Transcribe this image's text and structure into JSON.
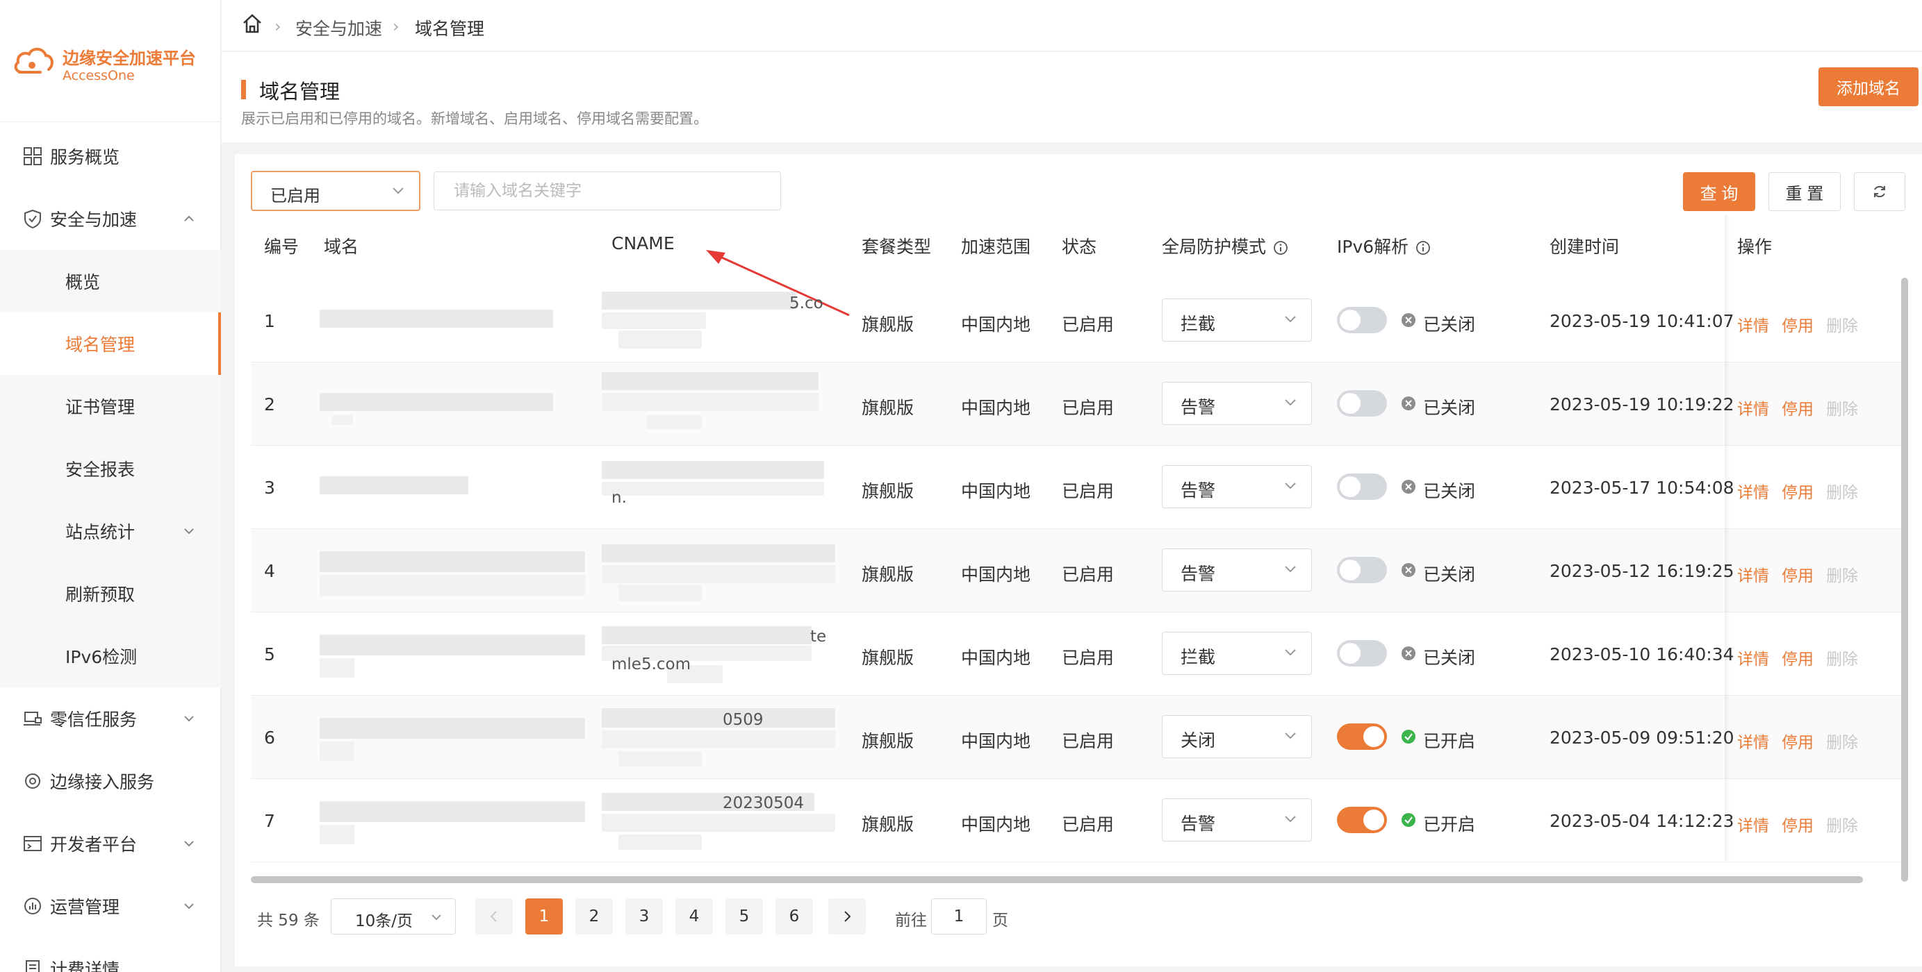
{
  "brand": {
    "name_cn": "边缘安全加速平台",
    "name_en": "AccessOne",
    "color": "#ec7b37"
  },
  "breadcrumb": [
    "安全与加速",
    "域名管理"
  ],
  "sidebar": {
    "items": [
      {
        "label": "服务概览",
        "icon": "grid-icon"
      },
      {
        "label": "安全与加速",
        "icon": "shield-icon",
        "expanded": true
      },
      {
        "label": "零信任服务",
        "icon": "laptop-lock-icon"
      },
      {
        "label": "边缘接入服务",
        "icon": "edge-icon"
      },
      {
        "label": "开发者平台",
        "icon": "console-icon"
      },
      {
        "label": "运营管理",
        "icon": "chart-icon"
      },
      {
        "label": "计费详情",
        "icon": "bill-icon"
      }
    ],
    "sub_items": [
      {
        "label": "概览"
      },
      {
        "label": "域名管理",
        "active": true
      },
      {
        "label": "证书管理"
      },
      {
        "label": "安全报表"
      },
      {
        "label": "站点统计"
      },
      {
        "label": "刷新预取"
      },
      {
        "label": "IPv6检测"
      }
    ]
  },
  "page": {
    "title": "域名管理",
    "description": "展示已启用和已停用的域名。新增域名、启用域名、停用域名需要配置。",
    "add_button": "添加域名"
  },
  "filters": {
    "status_value": "已启用",
    "search_placeholder": "请输入域名关键字",
    "query_button": "查 询",
    "reset_button": "重 置"
  },
  "table": {
    "headers": [
      "编号",
      "域名",
      "CNAME",
      "套餐类型",
      "加速范围",
      "状态",
      "全局防护模式",
      "IPv6解析",
      "创建时间",
      "操作"
    ],
    "rows": [
      {
        "id": "1",
        "cname_frag": "5.co",
        "cname_frag2": "",
        "plan": "旗舰版",
        "scope": "中国内地",
        "status": "已启用",
        "mode": "拦截",
        "ipv6_on": false,
        "ipv6_text": "已关闭",
        "created": "2023-05-19 10:41:07"
      },
      {
        "id": "2",
        "cname_frag": "",
        "cname_frag2": "",
        "plan": "旗舰版",
        "scope": "中国内地",
        "status": "已启用",
        "mode": "告警",
        "ipv6_on": false,
        "ipv6_text": "已关闭",
        "created": "2023-05-19 10:19:22"
      },
      {
        "id": "3",
        "cname_frag": "",
        "cname_frag2": "n.",
        "plan": "旗舰版",
        "scope": "中国内地",
        "status": "已启用",
        "mode": "告警",
        "ipv6_on": false,
        "ipv6_text": "已关闭",
        "created": "2023-05-17 10:54:08"
      },
      {
        "id": "4",
        "cname_frag": "",
        "cname_frag2": "",
        "plan": "旗舰版",
        "scope": "中国内地",
        "status": "已启用",
        "mode": "告警",
        "ipv6_on": false,
        "ipv6_text": "已关闭",
        "created": "2023-05-12 16:19:25"
      },
      {
        "id": "5",
        "cname_frag": "te",
        "cname_frag2": "mle5.com",
        "plan": "旗舰版",
        "scope": "中国内地",
        "status": "已启用",
        "mode": "拦截",
        "ipv6_on": false,
        "ipv6_text": "已关闭",
        "created": "2023-05-10 16:40:34"
      },
      {
        "id": "6",
        "cname_frag": "0509",
        "cname_frag2": "",
        "plan": "旗舰版",
        "scope": "中国内地",
        "status": "已启用",
        "mode": "关闭",
        "ipv6_on": true,
        "ipv6_text": "已开启",
        "created": "2023-05-09 09:51:20"
      },
      {
        "id": "7",
        "cname_frag": "20230504",
        "cname_frag2": "",
        "plan": "旗舰版",
        "scope": "中国内地",
        "status": "已启用",
        "mode": "告警",
        "ipv6_on": true,
        "ipv6_text": "已开启",
        "created": "2023-05-04 14:12:23"
      }
    ],
    "ops": {
      "detail": "详情",
      "disable": "停用",
      "delete": "删除"
    }
  },
  "pagination": {
    "total": "共 59 条",
    "page_size": "10条/页",
    "pages": [
      "1",
      "2",
      "3",
      "4",
      "5",
      "6"
    ],
    "current": "1",
    "goto_prefix": "前往",
    "goto_value": "1",
    "goto_suffix": "页"
  }
}
